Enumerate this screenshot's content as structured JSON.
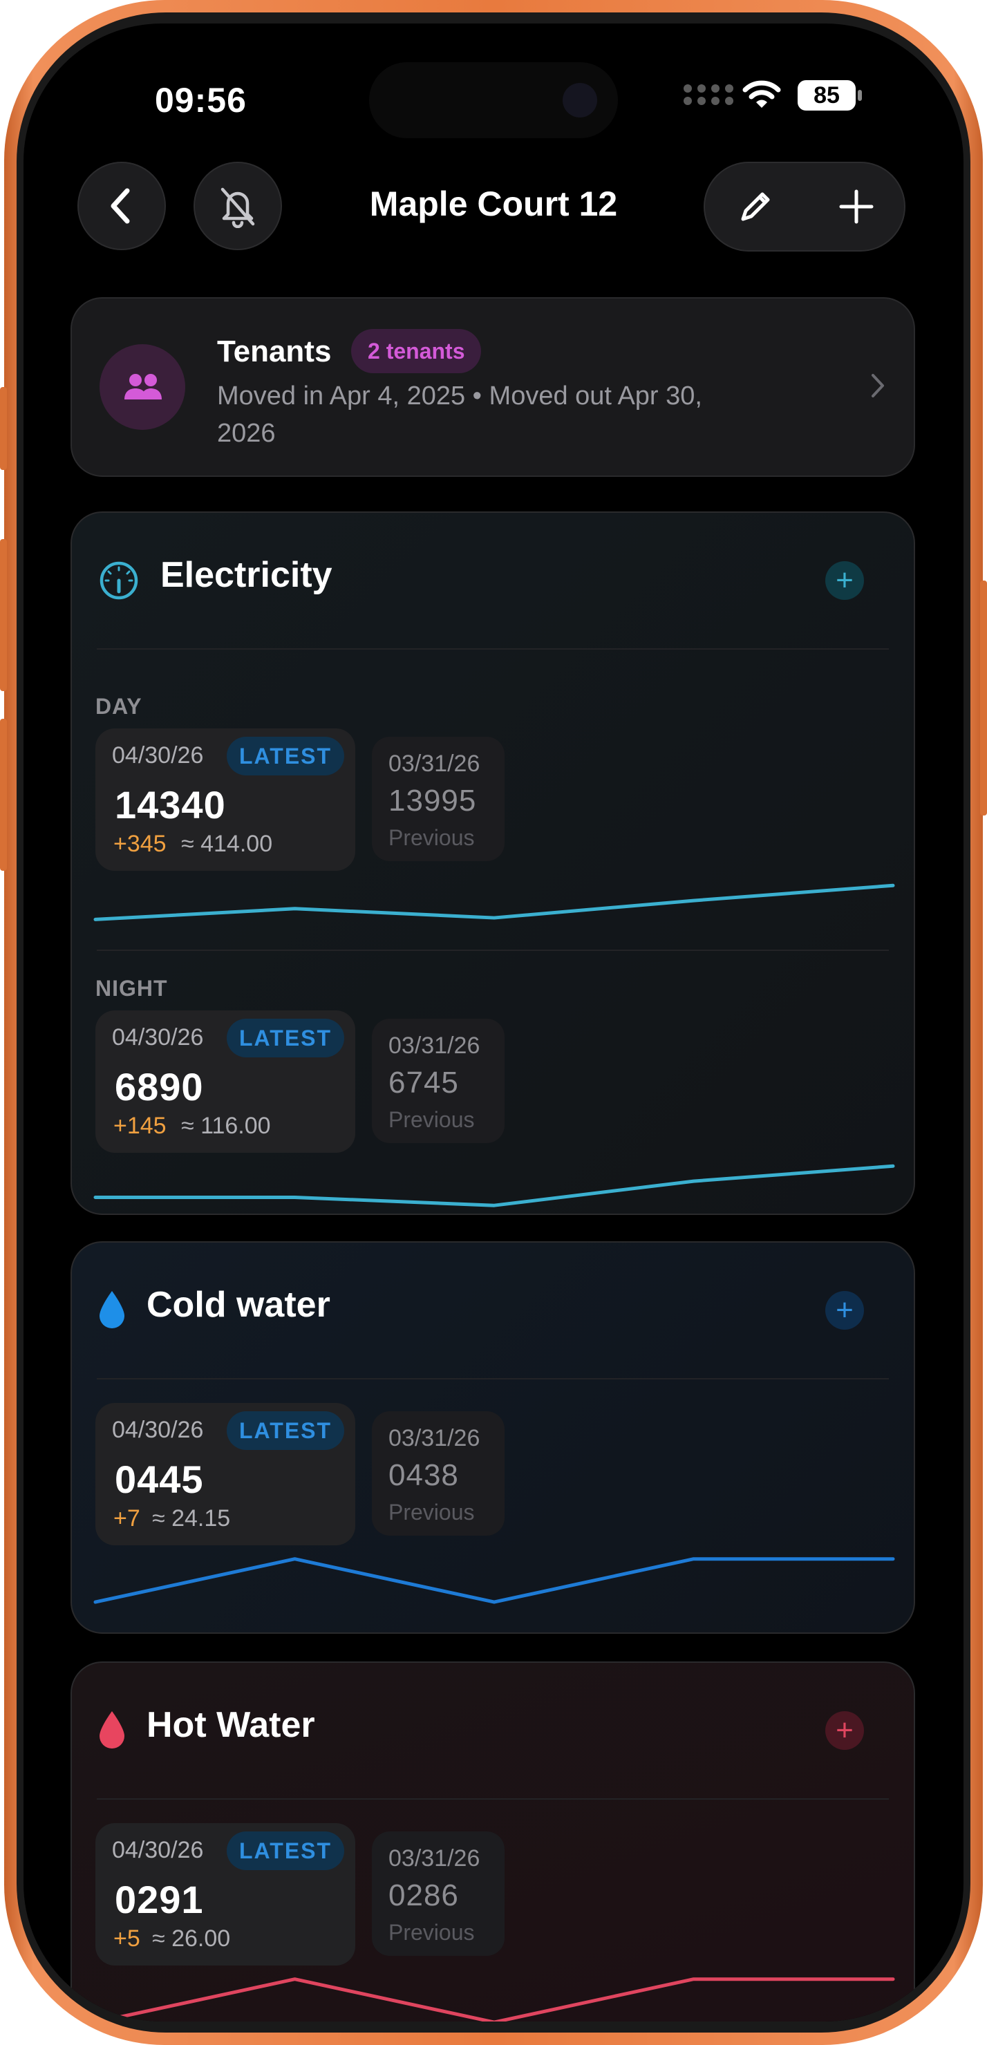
{
  "status_bar": {
    "time": "09:56",
    "battery": "85"
  },
  "header": {
    "title": "Maple Court 12",
    "back_icon": "chevron-left-icon",
    "mute_icon": "bell-slash-icon",
    "edit_icon": "pencil-icon",
    "add_icon": "plus-icon"
  },
  "tenants": {
    "title": "Tenants",
    "badge": "2 tenants",
    "subtitle": "Moved in Apr 4, 2025 • Moved out Apr 30, 2026",
    "icon": "people-icon",
    "accent": "#d45ad8"
  },
  "utilities": {
    "electricity": {
      "title": "Electricity",
      "icon": "gauge-icon",
      "color": "#3bb0d0",
      "add": "+",
      "day": {
        "label": "DAY",
        "latest": {
          "date": "04/30/26",
          "badge": "LATEST",
          "value": "14340",
          "delta": "+345",
          "cost": "≈ 414.00"
        },
        "previous": {
          "date": "03/31/26",
          "value": "13995",
          "label": "Previous"
        },
        "trend": [
          0.2,
          0.4,
          0.23,
          0.55,
          0.83
        ]
      },
      "night": {
        "label": "NIGHT",
        "latest": {
          "date": "04/30/26",
          "badge": "LATEST",
          "value": "6890",
          "delta": "+145",
          "cost": "≈ 116.00"
        },
        "previous": {
          "date": "03/31/26",
          "value": "6745",
          "label": "Previous"
        },
        "trend": [
          0.25,
          0.25,
          0.1,
          0.55,
          0.83
        ]
      }
    },
    "cold_water": {
      "title": "Cold water",
      "icon": "droplet-icon",
      "color": "#1e7bd6",
      "add": "+",
      "latest": {
        "date": "04/30/26",
        "badge": "LATEST",
        "value": "0445",
        "delta": "+7",
        "cost": "≈ 24.15"
      },
      "previous": {
        "date": "03/31/26",
        "value": "0438",
        "label": "Previous"
      },
      "trend": [
        0.05,
        0.85,
        0.05,
        0.85,
        0.85
      ]
    },
    "hot_water": {
      "title": "Hot Water",
      "icon": "droplet-icon",
      "color": "#e0455f",
      "add": "+",
      "latest": {
        "date": "04/30/26",
        "badge": "LATEST",
        "value": "0291",
        "delta": "+5",
        "cost": "≈ 26.00"
      },
      "previous": {
        "date": "03/31/26",
        "value": "0286",
        "label": "Previous"
      },
      "trend": [
        0.05,
        0.85,
        0.05,
        0.85,
        0.85
      ]
    }
  }
}
